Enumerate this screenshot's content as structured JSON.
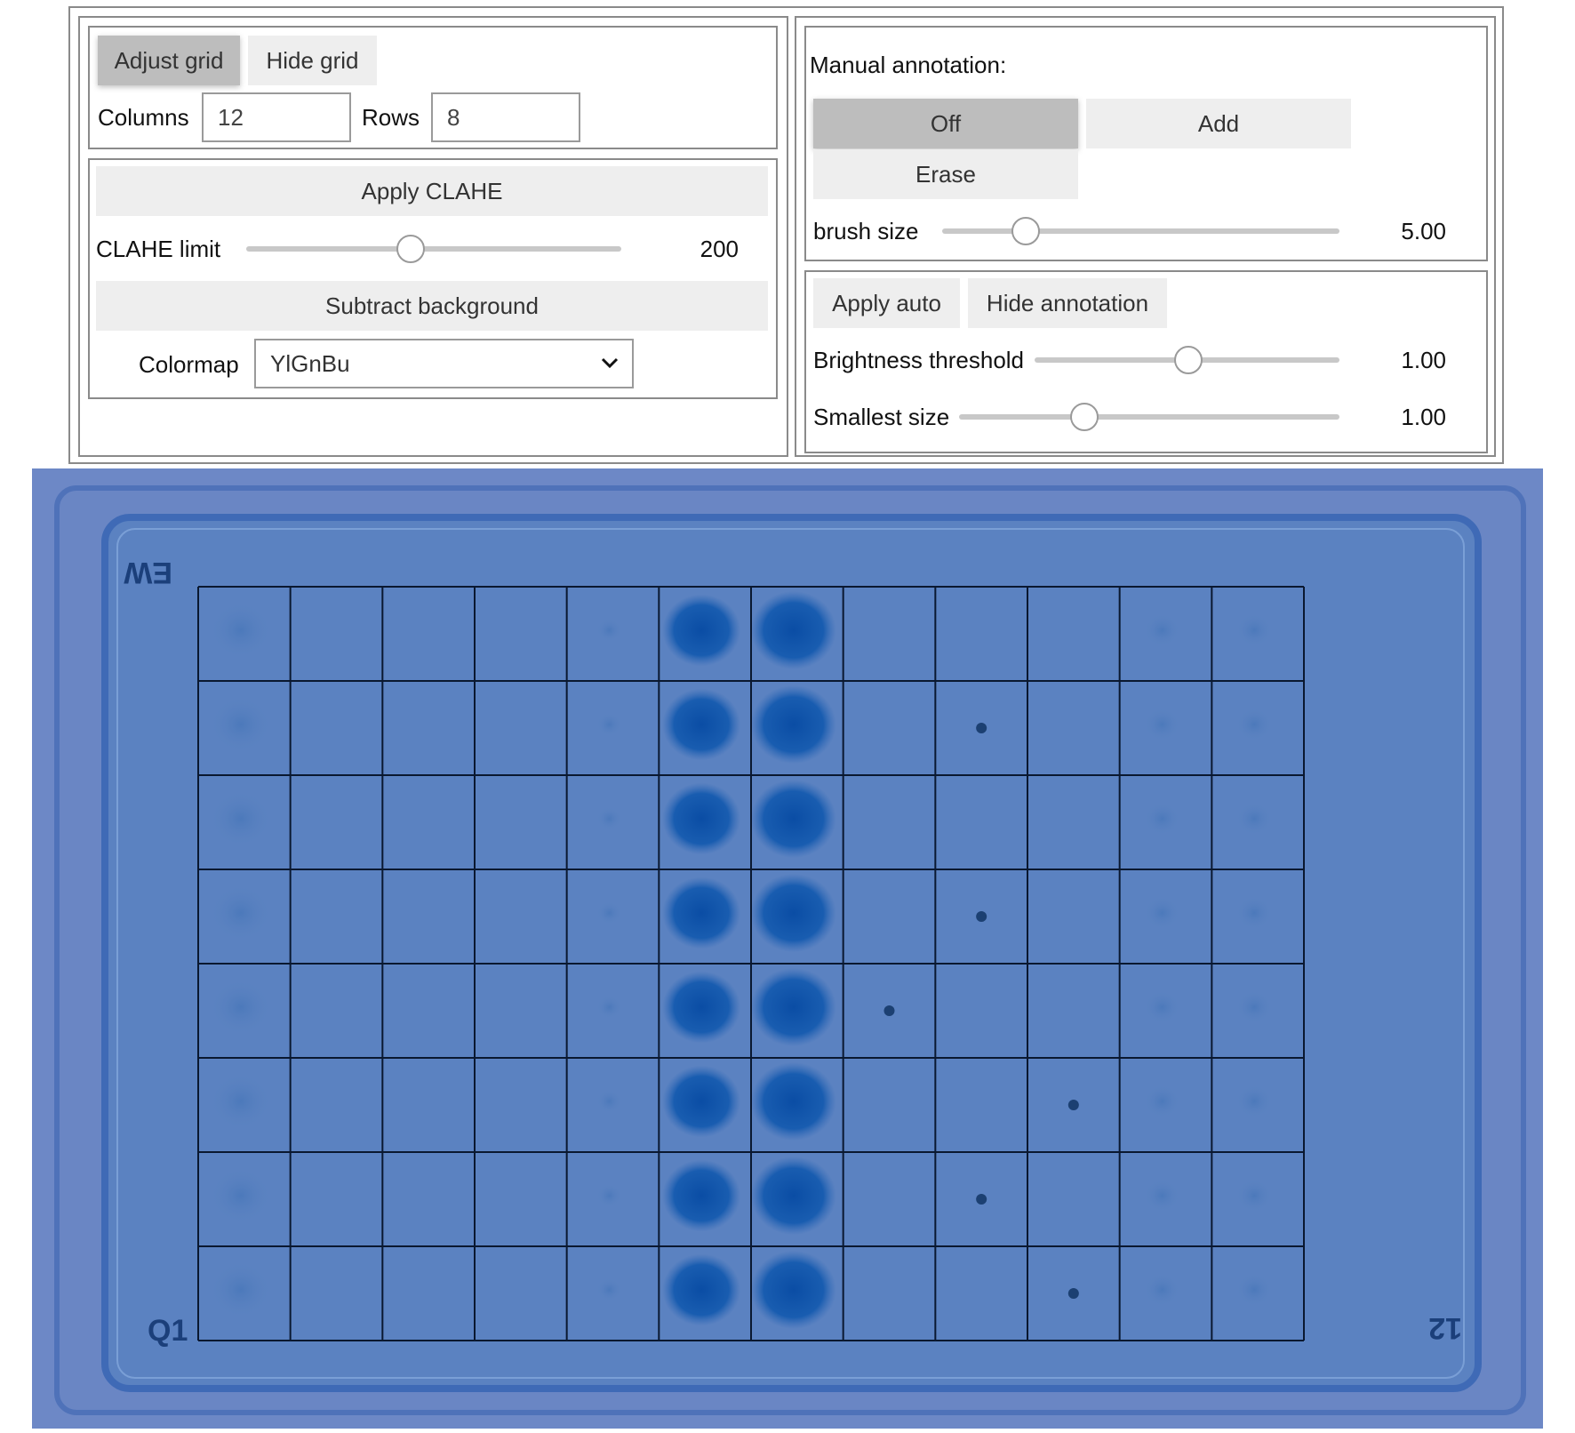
{
  "grid_panel": {
    "adjust_grid_label": "Adjust grid",
    "hide_grid_label": "Hide grid",
    "columns_label": "Columns",
    "columns_value": "12",
    "rows_label": "Rows",
    "rows_value": "8"
  },
  "clahe_panel": {
    "apply_clahe_label": "Apply CLAHE",
    "clahe_limit_label": "CLAHE limit",
    "clahe_limit_value": "200",
    "clahe_limit_fraction": 0.43,
    "subtract_background_label": "Subtract background",
    "colormap_label": "Colormap",
    "colormap_value": "YlGnBu"
  },
  "annotation_panel": {
    "title": "Manual annotation:",
    "mode_off": "Off",
    "mode_add": "Add",
    "mode_erase": "Erase",
    "selected_mode": "Off",
    "brush_size_label": "brush size",
    "brush_size_value": "5.00",
    "brush_size_fraction": 0.21
  },
  "auto_panel": {
    "apply_auto_label": "Apply auto",
    "hide_annotation_label": "Hide annotation",
    "brightness_threshold_label": "Brightness threshold",
    "brightness_threshold_value": "1.00",
    "brightness_threshold_fraction": 0.5,
    "smallest_size_label": "Smallest size",
    "smallest_size_value": "1.00",
    "smallest_size_fraction": 0.31
  },
  "plate": {
    "grid_columns": 12,
    "grid_rows": 8,
    "corner_marks": {
      "top_left": "EW",
      "bottom_left": "Q1",
      "bottom_right": "12"
    },
    "colors": {
      "background": "#6b86c4",
      "agar": "#5a80c0",
      "colony": "#0a4fa8",
      "grid_line": "#0a1830"
    }
  }
}
